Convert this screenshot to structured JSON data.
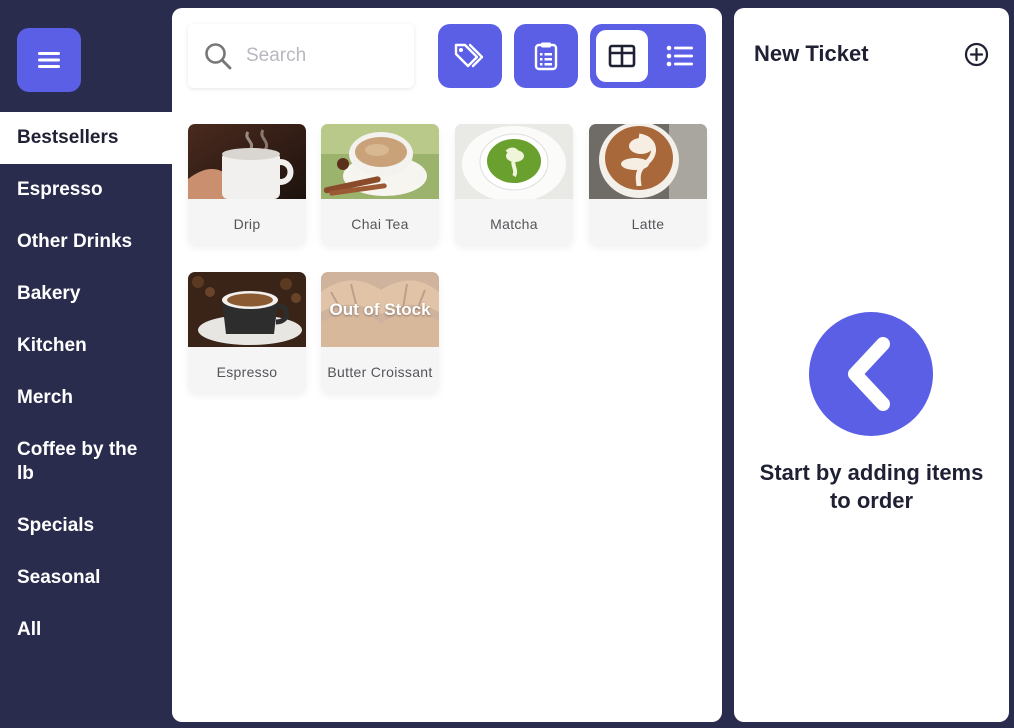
{
  "sidebar": {
    "menu_icon": "hamburger-menu-icon",
    "categories": [
      {
        "label": "Bestsellers",
        "active": true
      },
      {
        "label": "Espresso"
      },
      {
        "label": "Other Drinks"
      },
      {
        "label": "Bakery"
      },
      {
        "label": "Kitchen"
      },
      {
        "label": "Merch"
      },
      {
        "label": "Coffee by the lb"
      },
      {
        "label": "Specials"
      },
      {
        "label": "Seasonal"
      },
      {
        "label": "All"
      }
    ]
  },
  "toolbar": {
    "search_placeholder": "Search",
    "discount_icon": "tags-icon",
    "orders_icon": "clipboard-icon",
    "grid_view_icon": "grid-view-icon",
    "list_view_icon": "list-view-icon",
    "active_view": "grid"
  },
  "products": [
    {
      "name": "Drip"
    },
    {
      "name": "Chai Tea"
    },
    {
      "name": "Matcha"
    },
    {
      "name": "Latte"
    },
    {
      "name": "Espresso"
    },
    {
      "name": "Butter Croissant",
      "badge": "Out of Stock"
    }
  ],
  "ticket": {
    "title": "New Ticket",
    "add_icon": "plus-circle-icon",
    "empty_icon": "chevron-left-icon",
    "empty_message": "Start by adding items to order"
  },
  "colors": {
    "accent": "#5b5fe6",
    "sidebar_bg": "#2a2c4e",
    "text_dark": "#1f2033"
  }
}
